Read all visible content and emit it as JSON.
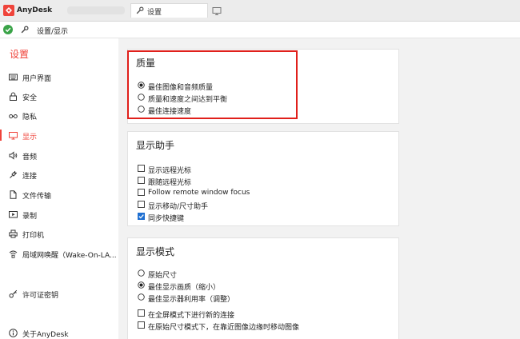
{
  "app": {
    "title": "AnyDesk",
    "brand_color": "#ef443b"
  },
  "tab": {
    "label": "设置",
    "icon": "wrench-icon"
  },
  "addressbar": {
    "breadcrumb": "设置/显示",
    "status_icon": "connected-check-icon"
  },
  "sidebar": {
    "title": "设置",
    "items": [
      {
        "label": "用户界面",
        "icon": "keyboard-icon"
      },
      {
        "label": "安全",
        "icon": "lock-icon"
      },
      {
        "label": "隐私",
        "icon": "glasses-icon"
      },
      {
        "label": "显示",
        "icon": "monitor-icon",
        "active": true
      },
      {
        "label": "音频",
        "icon": "speaker-icon"
      },
      {
        "label": "连接",
        "icon": "plug-icon"
      },
      {
        "label": "文件传输",
        "icon": "file-icon"
      },
      {
        "label": "录制",
        "icon": "record-icon"
      },
      {
        "label": "打印机",
        "icon": "printer-icon"
      },
      {
        "label": "局域网唤醒（Wake-On-LA...",
        "icon": "network-icon"
      },
      {
        "label": "许可证密钥",
        "icon": "key-icon"
      },
      {
        "label": "关于AnyDesk",
        "icon": "info-icon"
      }
    ]
  },
  "quality": {
    "title": "质量",
    "options": [
      {
        "label": "最佳图像和音频质量",
        "selected": true
      },
      {
        "label": "质量和速度之间达到平衡",
        "selected": false
      },
      {
        "label": "最佳连接速度",
        "selected": false
      }
    ]
  },
  "display_helper": {
    "title": "显示助手",
    "options": [
      {
        "label": "显示远程光标",
        "checked": false
      },
      {
        "label": "跟随远程光标",
        "checked": false
      },
      {
        "label": "Follow remote window focus",
        "checked": false
      },
      {
        "label": "显示移动/尺寸助手",
        "checked": false
      },
      {
        "label": "同步快捷键",
        "checked": true
      }
    ]
  },
  "display_mode": {
    "title": "显示模式",
    "radios": [
      {
        "label": "原始尺寸",
        "selected": false
      },
      {
        "label": "最佳显示画质（缩小）",
        "selected": true
      },
      {
        "label": "最佳显示器利用率（调整）",
        "selected": false
      }
    ],
    "checks": [
      {
        "label": "在全屏模式下进行新的连接",
        "checked": false
      },
      {
        "label": "在原始尺寸模式下，在靠近图像边缘时移动图像",
        "checked": false
      }
    ]
  }
}
